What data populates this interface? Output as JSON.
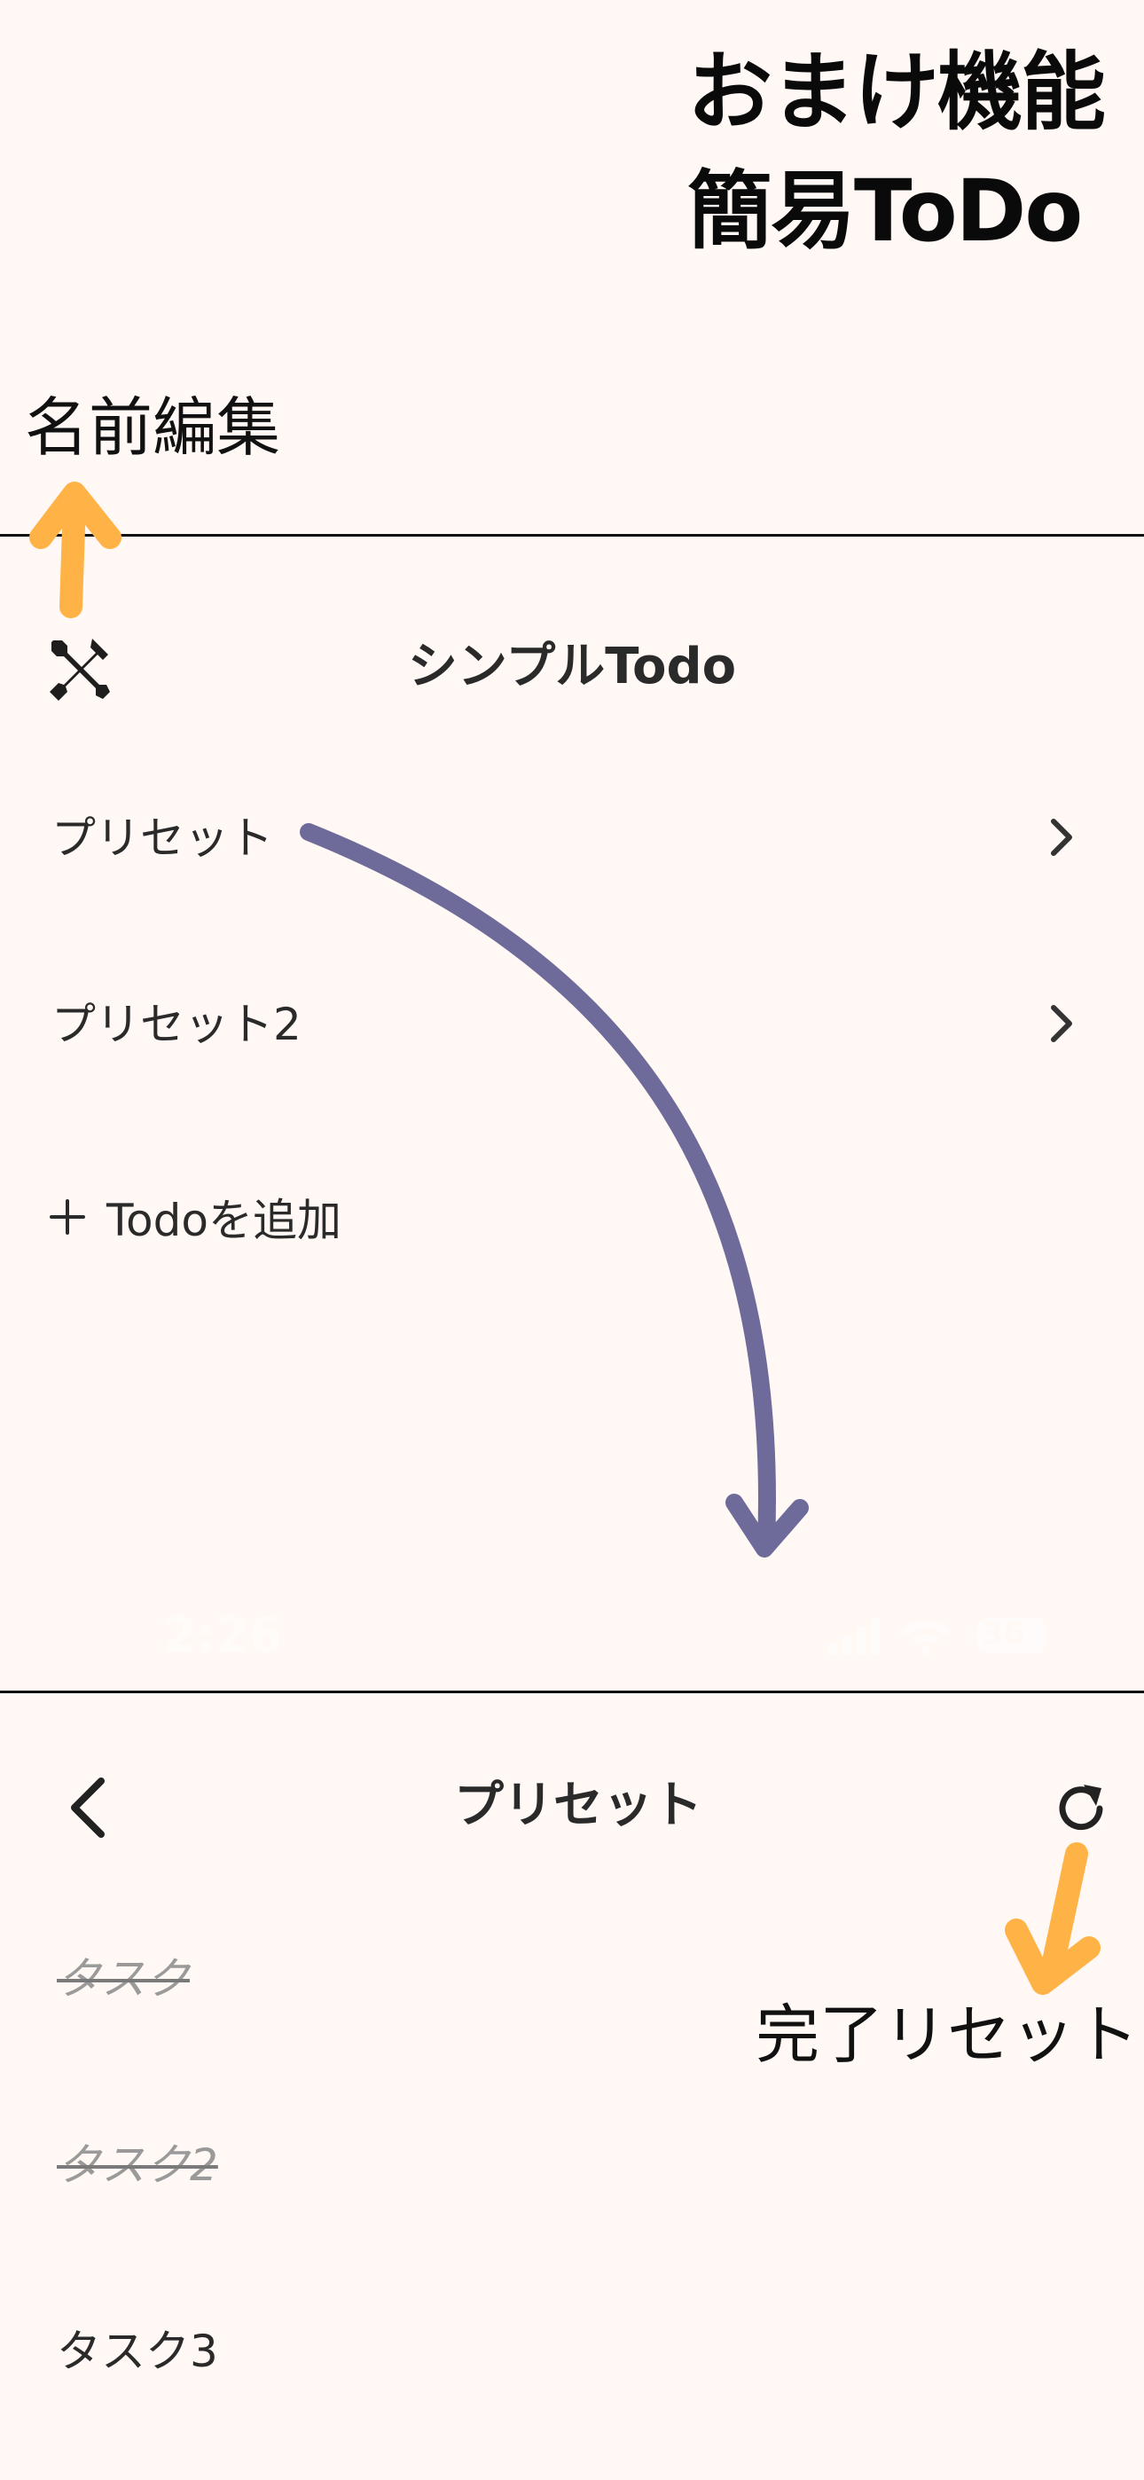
{
  "header": {
    "title_line1": "おまけ機能",
    "title_line2": "簡易ToDo"
  },
  "annotations": {
    "rename": "名前編集",
    "reset": "完了リセット"
  },
  "screen1": {
    "title": "シンプルTodo",
    "tool_icon": "tools-icon",
    "items": [
      {
        "label": "プリセット",
        "icon": "chevron-right-icon"
      },
      {
        "label": "プリセット2",
        "icon": "chevron-right-icon"
      }
    ],
    "add_label": "Todoを追加",
    "add_icon": "plus-icon"
  },
  "status_bar": {
    "time": "2:26",
    "battery": "36",
    "icons": [
      "signal-icon",
      "wifi-icon",
      "battery-icon"
    ]
  },
  "screen2": {
    "title": "プリセット",
    "back_icon": "chevron-left-icon",
    "reset_icon": "refresh-icon",
    "tasks": [
      {
        "label": "タスク",
        "done": true
      },
      {
        "label": "タスク2",
        "done": true
      },
      {
        "label": "タスク3",
        "done": false
      }
    ]
  },
  "colors": {
    "background": "#fff8f4",
    "annotation_arrow": "#ffb347",
    "flow_arrow": "#6e6b9a",
    "text": "#222222"
  }
}
